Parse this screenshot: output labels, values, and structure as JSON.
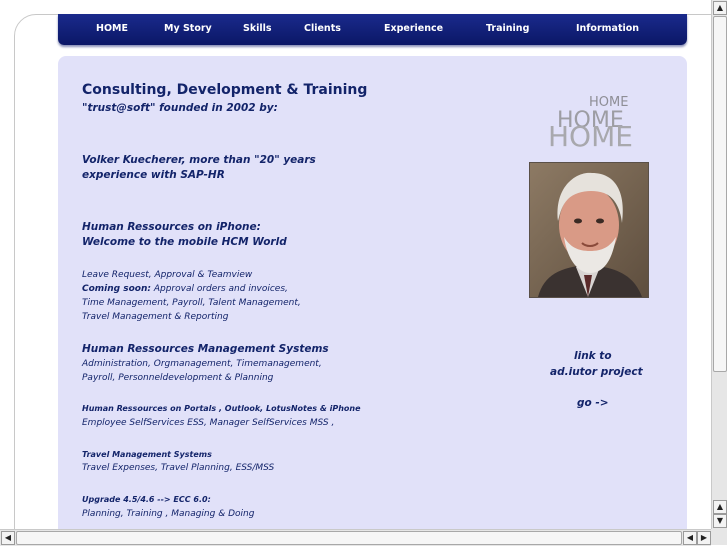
{
  "nav": {
    "items": [
      {
        "label": "HOME"
      },
      {
        "label": "My Story"
      },
      {
        "label": "Skills"
      },
      {
        "label": "Clients"
      },
      {
        "label": "Experience"
      },
      {
        "label": "Training"
      },
      {
        "label": "Information"
      }
    ]
  },
  "content": {
    "title": "Consulting, Development & Training",
    "subtitle": "\"trust@soft\" founded in 2002 by:",
    "founder_line1": "Volker Kuecherer, more than \"20\" years",
    "founder_line2": "experience with SAP-HR",
    "iphone_line1": "Human Ressources on iPhone:",
    "iphone_line2": "Welcome to the mobile HCM World",
    "iphone_detail1": "Leave Request, Approval & Teamview",
    "iphone_detail2_bold": "Coming soon:",
    "iphone_detail2_rest": " Approval orders and invoices,",
    "iphone_detail3": "Time Management, Payroll, Talent Management,",
    "iphone_detail4": "Travel Management & Reporting",
    "hrms_title": "Human Ressources Management Systems",
    "hrms_detail1": "Administration, Orgmanagement, Timemanagement,",
    "hrms_detail2": "Payroll, Personneldevelopment & Planning",
    "portals_title": "Human Ressources on Portals , Outlook, LotusNotes & iPhone",
    "portals_detail": "Employee SelfServices ESS, Manager SelfServices MSS ,",
    "travel_title": "Travel Management Systems",
    "travel_detail": "Travel Expenses, Travel Planning, ESS/MSS",
    "upgrade_title": "Upgrade 4.5/4.6 --> ECC 6.0:",
    "upgrade_detail": "Planning, Training , Managing & Doing"
  },
  "sidebar": {
    "home_small": "HOME",
    "home_medium": "HOME",
    "home_large": "HOME",
    "link_line1": "link to",
    "link_line2": "ad.iutor project",
    "go_label": "go ->"
  },
  "colors": {
    "nav_bg": "#0b1766",
    "panel_bg": "#e1e1f9",
    "text": "#13246a"
  },
  "icons": {
    "scroll_up": "triangle-up-icon",
    "scroll_down": "triangle-down-icon",
    "scroll_left": "triangle-left-icon",
    "scroll_right": "triangle-right-icon"
  }
}
